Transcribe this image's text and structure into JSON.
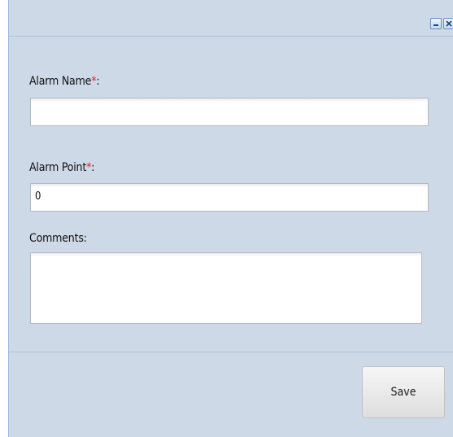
{
  "window": {
    "tools": [
      "minimize-icon",
      "close-icon"
    ]
  },
  "form": {
    "alarm_name": {
      "label": "Alarm Name",
      "required_mark": "*",
      "suffix": ":",
      "value": ""
    },
    "alarm_point": {
      "label": "Alarm Point",
      "required_mark": "*",
      "suffix": ":",
      "value": "0"
    },
    "comments": {
      "label": "Comments:",
      "value": ""
    }
  },
  "footer": {
    "save_label": "Save"
  },
  "colors": {
    "panel_background": "#ced9e7",
    "required_mark": "#e41c1c",
    "border": "#a9c2e6"
  }
}
